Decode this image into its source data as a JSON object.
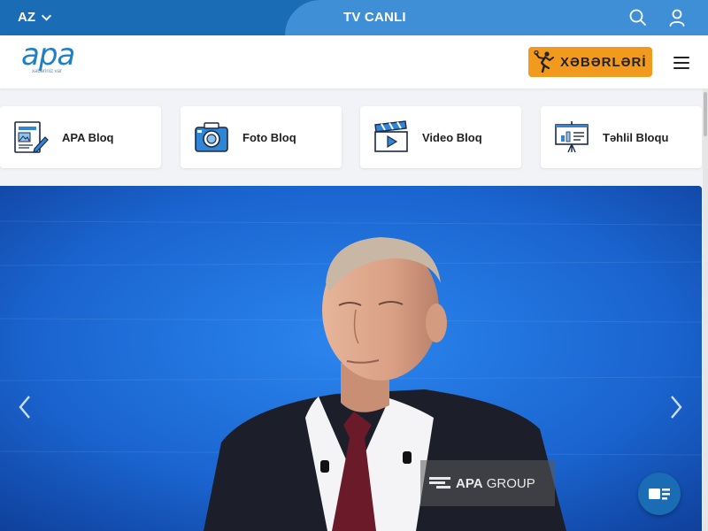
{
  "topbar": {
    "language": "AZ",
    "tv_label": "TV CANLI",
    "icons": [
      "search-icon",
      "user-icon",
      "chevron-down-icon"
    ]
  },
  "header": {
    "logo_text": "apa",
    "logo_tagline": "xəbəriniz var",
    "news_button_label": "XƏBƏRLƏRİ",
    "colors": {
      "accent": "#f29a1e",
      "brand": "#1a6cb4",
      "tv_tab": "#3f8fd6"
    }
  },
  "blogs": [
    {
      "label": "APA Bloq",
      "icon": "blog-document-icon"
    },
    {
      "label": "Foto Bloq",
      "icon": "camera-icon"
    },
    {
      "label": "Video Bloq",
      "icon": "clapperboard-icon"
    },
    {
      "label": "Təhlil Bloqu",
      "icon": "presentation-chart-icon"
    }
  ],
  "hero": {
    "watermark_brand": "APA",
    "watermark_group": " GROUP"
  }
}
